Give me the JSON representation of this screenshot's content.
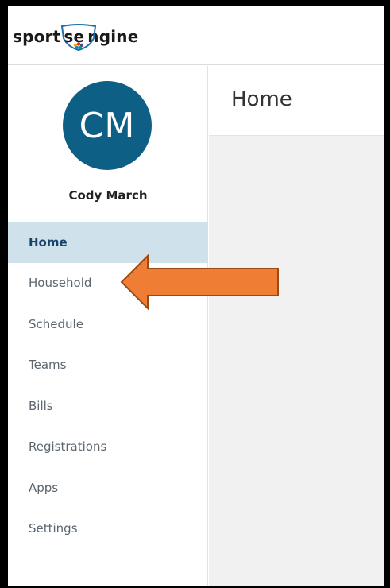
{
  "brand": {
    "pre": "sport",
    "mid": "se",
    "post": "ngine"
  },
  "user": {
    "initials": "CM",
    "name": "Cody March"
  },
  "nav": {
    "items": [
      {
        "label": "Home",
        "active": true
      },
      {
        "label": "Household"
      },
      {
        "label": "Schedule"
      },
      {
        "label": "Teams"
      },
      {
        "label": "Bills"
      },
      {
        "label": "Registrations"
      },
      {
        "label": "Apps"
      },
      {
        "label": "Settings"
      }
    ]
  },
  "page": {
    "title": "Home"
  },
  "colors": {
    "avatar": "#0e5f86",
    "active_nav_bg": "#cfe1ea",
    "active_nav_text": "#17456a",
    "arrow_fill": "#ef7d34",
    "arrow_stroke": "#9a4a12",
    "content_bg": "#f1f1f2"
  },
  "icons": {
    "logo_shield": "nbc-peacock-shield-icon",
    "annotation": "left-arrow-annotation"
  }
}
